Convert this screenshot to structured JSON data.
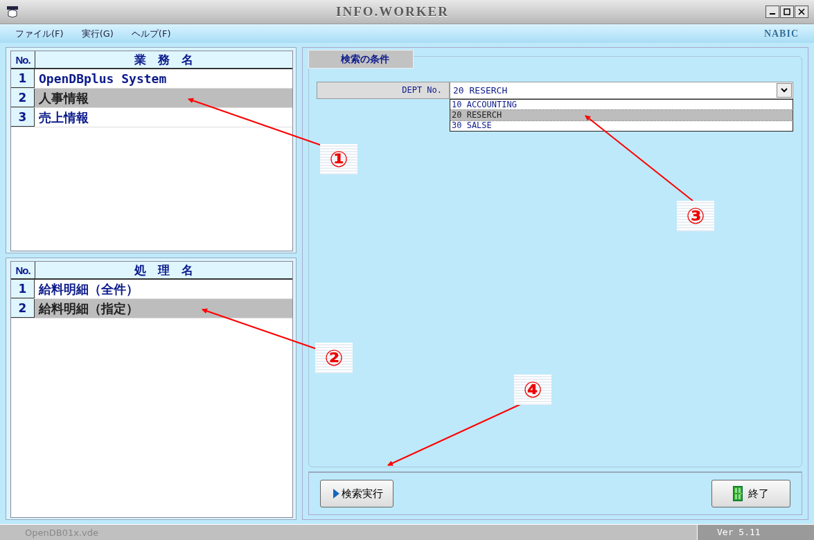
{
  "window": {
    "title": "INFO.WORKER",
    "logo_text": "NABIC"
  },
  "menu": [
    "ファイル(F)",
    "実行(G)",
    "ヘルプ(F)"
  ],
  "jobs": {
    "columns": [
      "No.",
      "業　務　名"
    ],
    "rows": [
      {
        "no": "1",
        "name": "OpenDBplus System",
        "selected": false
      },
      {
        "no": "2",
        "name": "人事情報",
        "selected": true
      },
      {
        "no": "3",
        "name": "売上情報",
        "selected": false
      }
    ]
  },
  "processes": {
    "columns": [
      "No.",
      "処　理　名"
    ],
    "rows": [
      {
        "no": "1",
        "name": "給料明細（全件）",
        "selected": false
      },
      {
        "no": "2",
        "name": "給料明細（指定）",
        "selected": true
      }
    ]
  },
  "search": {
    "title": "検索の条件",
    "field_label": "DEPT No.",
    "value": "20 RESERCH",
    "options": [
      {
        "label": "10 ACCOUNTING",
        "selected": false
      },
      {
        "label": "20 RESERCH",
        "selected": true
      },
      {
        "label": "30 SALSE",
        "selected": false
      }
    ]
  },
  "buttons": {
    "run": "検索実行",
    "exit": "終了"
  },
  "status_bar": {
    "file": "OpenDB01x.vde",
    "version": "Ver 5.11"
  },
  "callouts": [
    {
      "label": "①"
    },
    {
      "label": "②"
    },
    {
      "label": "③"
    },
    {
      "label": "④"
    }
  ]
}
